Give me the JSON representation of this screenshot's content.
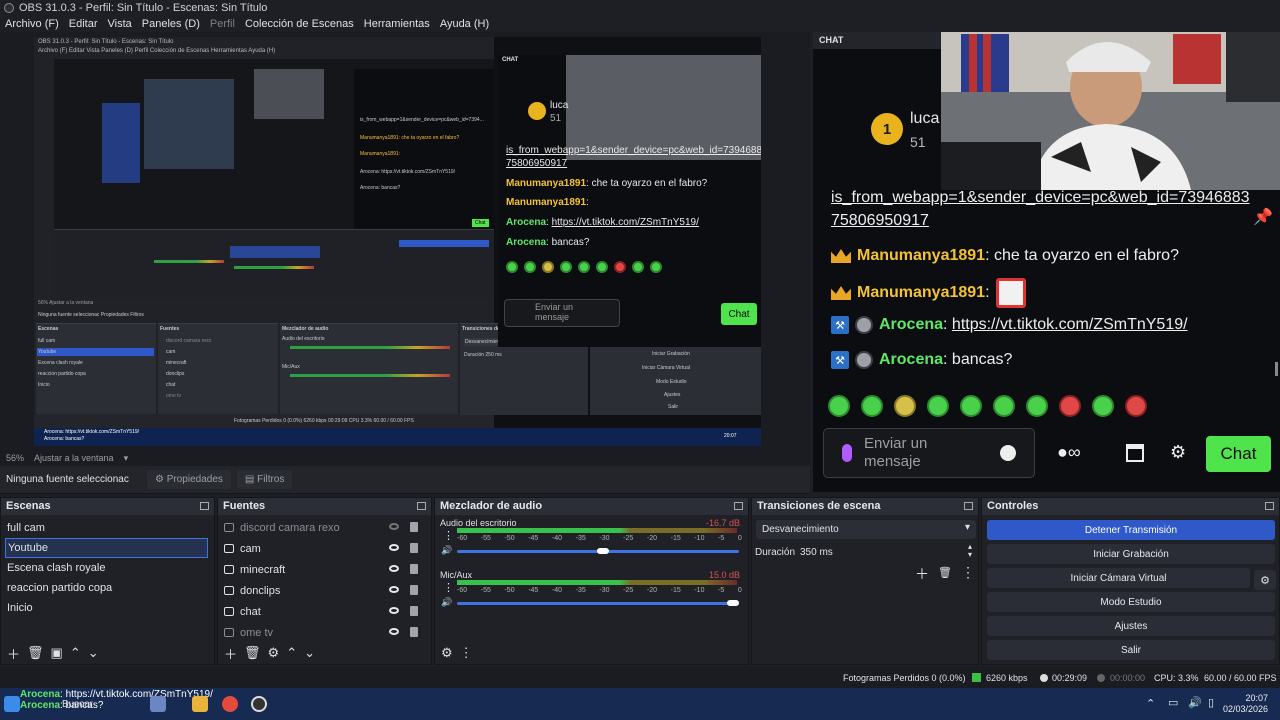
{
  "window": {
    "title": "OBS 31.0.3 - Perfil: Sin Título - Escenas: Sin Título"
  },
  "menu": [
    {
      "label": "Archivo (F)",
      "dim": false
    },
    {
      "label": "Editar",
      "dim": false
    },
    {
      "label": "Vista",
      "dim": false
    },
    {
      "label": "Paneles (D)",
      "dim": false
    },
    {
      "label": "Perfil",
      "dim": true
    },
    {
      "label": "Colección de Escenas",
      "dim": false
    },
    {
      "label": "Herramientas",
      "dim": false
    },
    {
      "label": "Ayuda (H)",
      "dim": false
    }
  ],
  "preview": {
    "zoom": "56%",
    "fit": "Ajustar a la ventana",
    "no_source": "Ninguna fuente seleccionac",
    "properties_tab": "Propiedades",
    "filters_tab": "Filtros"
  },
  "nested": {
    "title": "OBS 31.0.3 - Perfil: Sin Título - Escenas: Sin Título",
    "menu": "Archivo (F)   Editar   Vista   Paneles (D)   Perfil   Colección de Escenas   Herramientas   Ayuda (H)",
    "docks": [
      "Escenas",
      "Fuentes",
      "Mezclador de audio",
      "Transiciones de escena",
      "Controles"
    ],
    "scenes": [
      "full cam",
      "Youtube",
      "Escena clash royale",
      "reaccion partido copa",
      "Inicio"
    ],
    "sources": [
      "discord camara rexo",
      "cam",
      "minecraft",
      "donclips",
      "chat",
      "ome tv"
    ],
    "controls": [
      "Detener Transmisión",
      "Iniciar Grabación",
      "Iniciar Cámara Virtual",
      "Modo Estudio",
      "Ajustes",
      "Salir"
    ],
    "zoom": "56%",
    "fit": "Ajustar a la ventana",
    "no_source": "Ninguna fuente seleccionac",
    "properties": "Propiedades",
    "filters": "Filtros",
    "desktop_audio": "Audio del escritorio",
    "mic": "Mic/Aux",
    "mic_db": "-16.7 dB",
    "transition": "Desvanecimiento",
    "duration_label": "Duración",
    "duration": "250 ms",
    "status": "Fotogramas Perdidos 0 (0.0%)   6260 kbps   00:29:09   CPU 3.3%   60.00 / 60.00 FPS",
    "taskbar_line1": "Arocena: https://vt.tiktok.com/ZSmTnY519/",
    "taskbar_line2": "Arocena: bancas?",
    "clock": "20:07"
  },
  "mini_chat": {
    "header": "CHAT",
    "user": "luca",
    "count": "51",
    "url_line1": "is_from_webapp=1&sender_device=pc&web_id=73946883",
    "url_line2": "75806950917",
    "msg1_user": "Manumanya1891",
    "msg1_text": ": che ta oyarzo en el fabro?",
    "msg2_user": "Manumanya1891",
    "msg2_text": ":",
    "msg3_user": "Arocena",
    "msg3_text": ": ",
    "msg3_link": "https://vt.tiktok.com/ZSmTnY519/",
    "msg4_user": "Arocena",
    "msg4_text": ": bancas?",
    "input_placeholder": "Enviar un mensaje",
    "send": "Chat"
  },
  "chat": {
    "header": "CHAT",
    "badge_number": "1",
    "user": "luca",
    "count": "51",
    "url_line1": "is_from_webapp=1&sender_device=pc&web_id=73946883",
    "url_line2": "75806950917",
    "messages": [
      {
        "user": "Manumanya1891",
        "text": ": che ta oyarzo en el fabro?"
      },
      {
        "user": "Manumanya1891",
        "text": ":"
      },
      {
        "user": "Arocena",
        "text": ": ",
        "link": "https://vt.tiktok.com/ZSmTnY519/"
      },
      {
        "user": "Arocena",
        "text": ": bancas?"
      }
    ],
    "input_placeholder": "Enviar un mensaje",
    "send_label": "Chat",
    "emote_count": 10
  },
  "docks": {
    "scenes": {
      "title": "Escenas",
      "items": [
        "full cam",
        "Youtube",
        "Escena clash royale",
        "reaccion partido copa",
        "Inicio"
      ],
      "selected": 1
    },
    "sources": {
      "title": "Fuentes",
      "items": [
        {
          "name": "discord camara rexo",
          "visible": false,
          "dim": true,
          "icon": "display-capture-icon"
        },
        {
          "name": "cam",
          "visible": true,
          "dim": false,
          "icon": "camera-icon"
        },
        {
          "name": "minecraft",
          "visible": true,
          "dim": false,
          "icon": "game-capture-icon"
        },
        {
          "name": "donclips",
          "visible": true,
          "dim": false,
          "icon": "browser-icon"
        },
        {
          "name": "chat",
          "visible": true,
          "dim": false,
          "icon": "browser-icon"
        },
        {
          "name": "ome tv",
          "visible": true,
          "dim": true,
          "icon": "window-capture-icon"
        }
      ]
    },
    "mixer": {
      "title": "Mezclador de audio",
      "channels": [
        {
          "name": "Audio del escritorio",
          "db": "-16.7 dB",
          "volume": 0.52
        },
        {
          "name": "Mic/Aux",
          "db": "15.0 dB",
          "volume": 1.0
        }
      ],
      "scale": [
        "-60",
        "-55",
        "-50",
        "-45",
        "-40",
        "-35",
        "-30",
        "-25",
        "-20",
        "-15",
        "-10",
        "-5",
        "0"
      ]
    },
    "transitions": {
      "title": "Transiciones de escena",
      "selected": "Desvanecimiento",
      "duration_label": "Duración",
      "duration_value": "350 ms"
    },
    "controls": {
      "title": "Controles",
      "buttons": [
        {
          "label": "Detener Transmisión",
          "active": true
        },
        {
          "label": "Iniciar Grabación",
          "active": false
        },
        {
          "label": "Iniciar Cámara Virtual",
          "active": false
        },
        {
          "label": "Modo Estudio",
          "active": false
        },
        {
          "label": "Ajustes",
          "active": false
        },
        {
          "label": "Salir",
          "active": false
        }
      ]
    }
  },
  "status": {
    "dropped": "Fotogramas Perdidos 0 (0.0%)",
    "bitrate": "6260 kbps",
    "stream_time": "00:29:09",
    "rec_time": "00:00:00",
    "cpu": "CPU: 3.3%",
    "fps": "60.00 / 60.00 FPS"
  },
  "taskbar": {
    "overlay_user1": "Arocena",
    "overlay_text1": ": https://vt.tiktok.com/ZSmTnY519/",
    "overlay_user2": "Arocena",
    "overlay_text2": ": bancas?",
    "search": "Buscar",
    "time": "20:07",
    "date": "02/03/2026"
  }
}
